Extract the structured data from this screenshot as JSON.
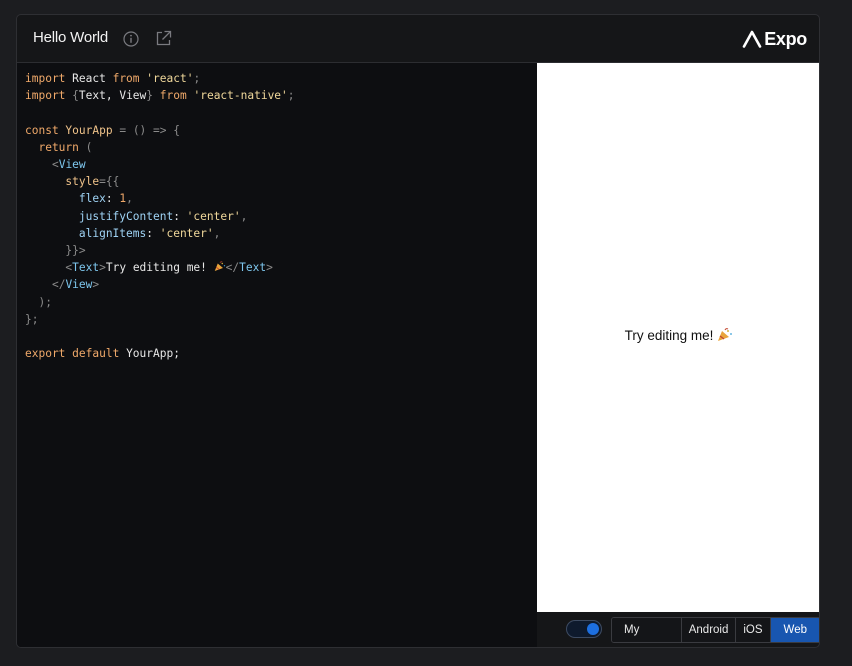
{
  "header": {
    "title": "Hello World",
    "logo_text": "Expo"
  },
  "icons": {
    "info": "info-icon",
    "open_external": "external-link-icon",
    "logo_mark": "expo-logo-mark",
    "emoji": "party-popper-emoji"
  },
  "editor": {
    "lines": [
      [
        "import",
        " React ",
        "from",
        " ",
        "'react'",
        ";"
      ],
      [
        "import",
        " ",
        "{",
        "Text, View",
        "}",
        " ",
        "from",
        " ",
        "'react-native'",
        ";"
      ],
      [],
      [
        "const",
        " YourApp ",
        "=",
        " ",
        "()",
        " ",
        "=>",
        " ",
        "{"
      ],
      [
        "  return",
        " ("
      ],
      [
        "    ",
        "<",
        "View"
      ],
      [
        "      style",
        "=",
        "{{"
      ],
      [
        "        flex",
        ": ",
        "1",
        ","
      ],
      [
        "        justifyContent",
        ": ",
        "'center'",
        ","
      ],
      [
        "        alignItems",
        ": ",
        "'center'",
        ","
      ],
      [
        "      ",
        "}}",
        ">"
      ],
      [
        "      ",
        "<",
        "Text",
        ">",
        "Try editing me! ",
        "</",
        "Text",
        ">"
      ],
      [
        "    ",
        "</",
        "View",
        ">"
      ],
      [
        "  ",
        ");"
      ],
      [
        "};"
      ],
      [],
      [
        "export",
        " ",
        "default",
        " YourApp;"
      ]
    ]
  },
  "preview": {
    "text": "Try editing me!"
  },
  "bottom": {
    "toggle_on": true,
    "tabs": [
      "My Device",
      "Android",
      "iOS",
      "Web"
    ],
    "active_tab": "Web"
  },
  "colors": {
    "accent": "#1856b0",
    "toggle_knob": "#1d6fe0",
    "editor_bg": "#0d0e11",
    "keyword": "#f0a96a",
    "string": "#f0d89b",
    "tag": "#7ec7ee"
  }
}
